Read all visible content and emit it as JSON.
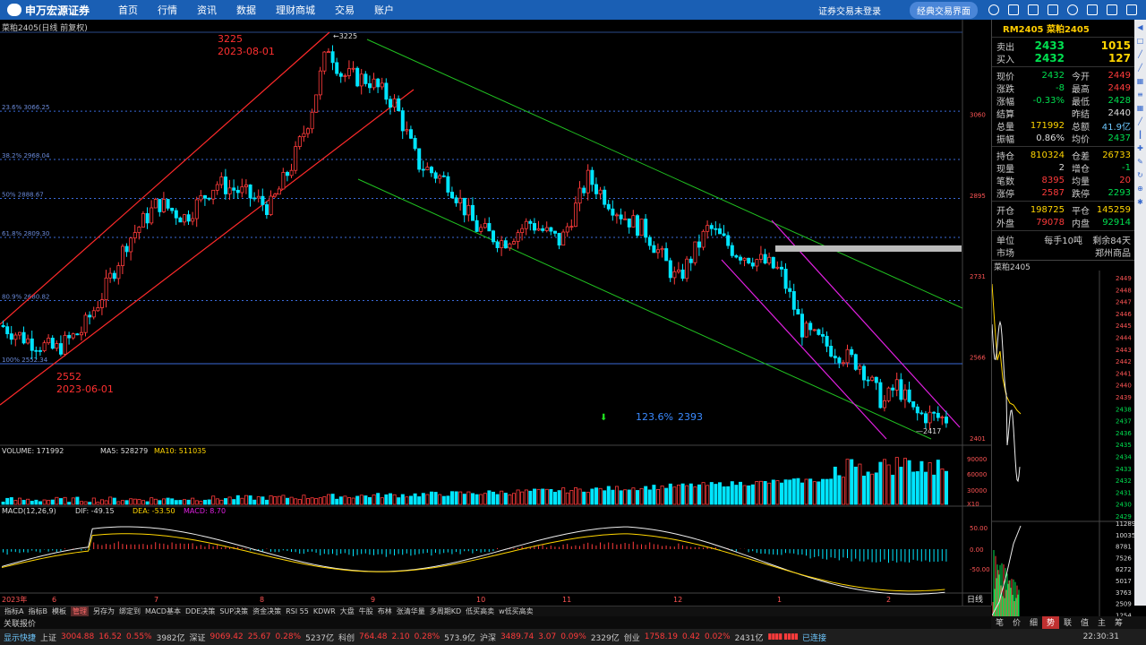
{
  "app": {
    "brand": "申万宏源证券",
    "menu": [
      "首页",
      "行情",
      "资讯",
      "数据",
      "理财商城",
      "交易",
      "账户"
    ],
    "login_status": "证券交易未登录",
    "classic_button": "经典交易界面"
  },
  "chart": {
    "title": "菜粕2405(日线 前复权)",
    "high_label_price": "3225",
    "high_label_date": "2023-08-01",
    "high_marker": "3225",
    "low_label_price": "2552",
    "low_label_date": "2023-06-01",
    "low_marker": "2417",
    "fib_projection": "123.6%",
    "fib_projection_value": "2393",
    "fib_levels": [
      {
        "label": "23.6% 3066.25",
        "value": 3066.25
      },
      {
        "label": "38.2% 2968.04",
        "value": 2968.04
      },
      {
        "label": "50% 2888.67",
        "value": 2888.67
      },
      {
        "label": "61.8% 2809.30",
        "value": 2809.3
      },
      {
        "label": "80.9% 2680.82",
        "value": 2680.82
      },
      {
        "label": "100% 2552.34",
        "value": 2552.34
      }
    ],
    "y_ticks": [
      "3060",
      "2895",
      "2731",
      "2566",
      "2401"
    ],
    "volume_label": "VOLUME: 171992",
    "ma5_label": "MA5: 528279",
    "ma10_label": "MA10: 511035",
    "vol_ticks": [
      "90000",
      "60000",
      "30000",
      "X10"
    ],
    "macd_label": "MACD(12,26,9)",
    "dif_label": "DIF: -49.15",
    "dea_label": "DEA: -53.50",
    "macd_value_label": "MACD: 8.70",
    "macd_ticks": [
      "50.00",
      "0.00",
      "-50.00"
    ],
    "x_labels": [
      "2023年",
      "6",
      "7",
      "8",
      "9",
      "10",
      "11",
      "12",
      "1",
      "2"
    ],
    "period_label": "日线"
  },
  "chart_data": {
    "type": "candlestick",
    "title": "菜粕2405(日线 前复权)",
    "high": {
      "price": 3225,
      "date": "2023-08-01"
    },
    "low": {
      "price": 2552,
      "date": "2023-06-01"
    },
    "latest_low": 2417,
    "projection": {
      "level": "123.6%",
      "price": 2393
    },
    "fib_retracements": [
      3066.25,
      2968.04,
      2888.67,
      2809.3,
      2680.82,
      2552.34
    ],
    "ylim": [
      2401,
      3225
    ],
    "volume": {
      "last": 171992,
      "ma5": 528279,
      "ma10": 511035
    },
    "macd": {
      "dif": -49.15,
      "dea": -53.5,
      "macd": 8.7
    }
  },
  "quote": {
    "title": "RM2405 菜粕2405",
    "sell_label": "卖出",
    "sell_price": "2433",
    "sell_vol": "1015",
    "buy_label": "买入",
    "buy_price": "2432",
    "buy_vol": "127",
    "rows": [
      [
        "现价",
        "2432",
        "今开",
        "2449"
      ],
      [
        "涨跌",
        "-8",
        "最高",
        "2449"
      ],
      [
        "涨幅",
        "-0.33%",
        "最低",
        "2428"
      ],
      [
        "结算",
        "",
        "昨结",
        "2440"
      ],
      [
        "总量",
        "171992",
        "总额",
        "41.9亿"
      ],
      [
        "振幅",
        "0.86%",
        "均价",
        "2437"
      ]
    ],
    "rows2": [
      [
        "持仓",
        "810324",
        "仓差",
        "26733"
      ],
      [
        "现量",
        "2",
        "增仓",
        "-1"
      ],
      [
        "笔数",
        "8395",
        "均量",
        "20"
      ],
      [
        "涨停",
        "2587",
        "跌停",
        "2293"
      ]
    ],
    "rows3": [
      [
        "开仓",
        "198725",
        "平仓",
        "145259"
      ],
      [
        "外盘",
        "79078",
        "内盘",
        "92914"
      ]
    ],
    "unit_label": "单位",
    "unit_value": "每手10吨",
    "remain_label": "剩余84天",
    "market_label": "市场",
    "market_value": "郑州商品",
    "mini_title": "菜粕2405",
    "mini_ticks": [
      "2449",
      "2448",
      "2447",
      "2446",
      "2445",
      "2444",
      "2443",
      "2442",
      "2441",
      "2440",
      "2439",
      "2438",
      "2437",
      "2436",
      "2435",
      "2434",
      "2433",
      "2432",
      "2431",
      "2430",
      "2429"
    ],
    "mini_vol_ticks": [
      "11289",
      "10035",
      "8781",
      "7526",
      "6272",
      "5017",
      "3763",
      "2509",
      "1254"
    ]
  },
  "tabs": [
    "指标A",
    "指标B",
    "模板",
    "管理",
    "另存为",
    "绑定到",
    "MACD基本",
    "DDE决策",
    "SUP决策",
    "资金决策",
    "RSI 55",
    "KDWR",
    "大盘",
    "牛股",
    "布林",
    "张清华量",
    "多周期KD",
    "低买高卖",
    "w低买高卖"
  ],
  "right_tabs": [
    "笔",
    "价",
    "细",
    "势",
    "联",
    "值",
    "主",
    "筹"
  ],
  "quote_bar_label": "关联报价",
  "status": {
    "display_label": "显示快捷",
    "sh_label": "上证",
    "sh_value": "3004.88",
    "sh_change": "16.52",
    "sh_pct": "0.55%",
    "sh_amount": "3982亿",
    "sz_label": "深证",
    "sz_value": "9069.42",
    "sz_change": "25.67",
    "sz_pct": "0.28%",
    "sz_amount": "5237亿",
    "kc_label": "科创",
    "kc_value": "764.48",
    "kc_change": "2.10",
    "kc_pct": "0.28%",
    "kc_amount": "573.9亿",
    "hs_label": "沪深",
    "hs_value": "3489.74",
    "hs_change": "3.07",
    "hs_pct": "0.09%",
    "hs_amount": "2329亿",
    "cy_label": "创业",
    "cy_value": "1758.19",
    "cy_change": "0.42",
    "cy_pct": "0.02%",
    "cy_amount": "2431亿",
    "connected": "已连接",
    "time": "22:30:31"
  },
  "colors": {
    "up": "#ff3b3b",
    "down": "#00e5ff",
    "brand": "#1a5fb4"
  }
}
